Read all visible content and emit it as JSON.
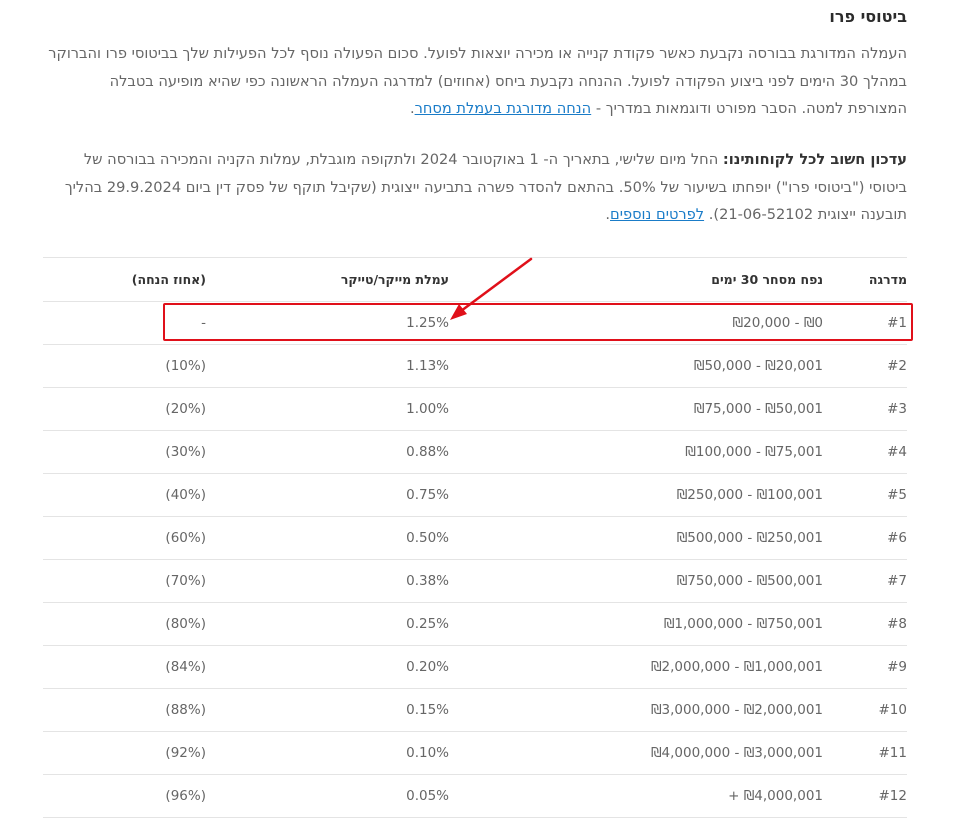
{
  "title": "ביטוסי פרו",
  "intro": {
    "text": "העמלה המדורגת בבורסה נקבעת כאשר פקודת קנייה או מכירה יוצאות לפועל. סכום הפעולה נוסף לכל הפעילות שלך בביטוסי פרו והברוקר במהלך 30 הימים לפני ביצוע הפקודה לפועל. ההנחה נקבעת ביחס (אחוזים) למדרגה העמלה הראשונה כפי שהיא מופיעה בטבלה המצורפת למטה. הסבר מפורט ודוגמאות במדריך - ",
    "link": "הנחה מדורגת בעמלת מסחר",
    "end": "."
  },
  "notice": {
    "bold": "עדכון חשוב לכל לקוחותינו:",
    "text": " החל מיום שלישי, בתאריך ה- 1 באוקטובר 2024 ולתקופה מוגבלת, עמלות הקניה והמכירה בבורסה של ביטוסי (\"ביטוסי פרו\") יופחתו בשיעור של 50%. בהתאם להסדר פשרה בתביעה ייצוגית (שקיבל תוקף של פסק דין ביום 29.9.2024 בהליך תובענה ייצוגית 21-06-52102). ",
    "link": "לפרטים נוספים",
    "end": "."
  },
  "table": {
    "headers": {
      "tier": "מדרגה",
      "range": "נפח מסחר 30 ימים",
      "fee": "עמלת מייקר/טייקר",
      "discount": "(אחוז הנחה)"
    },
    "rows": [
      {
        "tier": "#1",
        "range": "₪0 - ₪20,000",
        "fee": "1.25%",
        "discount": "-"
      },
      {
        "tier": "#2",
        "range": "₪20,001 - ₪50,000",
        "fee": "1.13%",
        "discount": "(10%)"
      },
      {
        "tier": "#3",
        "range": "₪50,001 - ₪75,000",
        "fee": "1.00%",
        "discount": "(20%)"
      },
      {
        "tier": "#4",
        "range": "₪75,001 - ₪100,000",
        "fee": "0.88%",
        "discount": "(30%)"
      },
      {
        "tier": "#5",
        "range": "₪100,001 - ₪250,000",
        "fee": "0.75%",
        "discount": "(40%)"
      },
      {
        "tier": "#6",
        "range": "₪250,001 - ₪500,000",
        "fee": "0.50%",
        "discount": "(60%)"
      },
      {
        "tier": "#7",
        "range": "₪500,001 - ₪750,000",
        "fee": "0.38%",
        "discount": "(70%)"
      },
      {
        "tier": "#8",
        "range": "₪750,001 - ₪1,000,000",
        "fee": "0.25%",
        "discount": "(80%)"
      },
      {
        "tier": "#9",
        "range": "₪1,000,001 - ₪2,000,000",
        "fee": "0.20%",
        "discount": "(84%)"
      },
      {
        "tier": "#10",
        "range": "₪2,000,001 - ₪3,000,000",
        "fee": "0.15%",
        "discount": "(88%)"
      },
      {
        "tier": "#11",
        "range": "₪3,000,001 - ₪4,000,000",
        "fee": "0.10%",
        "discount": "(92%)"
      },
      {
        "tier": "#12",
        "range": "₪4,000,001 +",
        "fee": "0.05%",
        "discount": "(96%)"
      }
    ]
  },
  "colors": {
    "highlight": "#e0101a",
    "link": "#1a7cc8"
  }
}
